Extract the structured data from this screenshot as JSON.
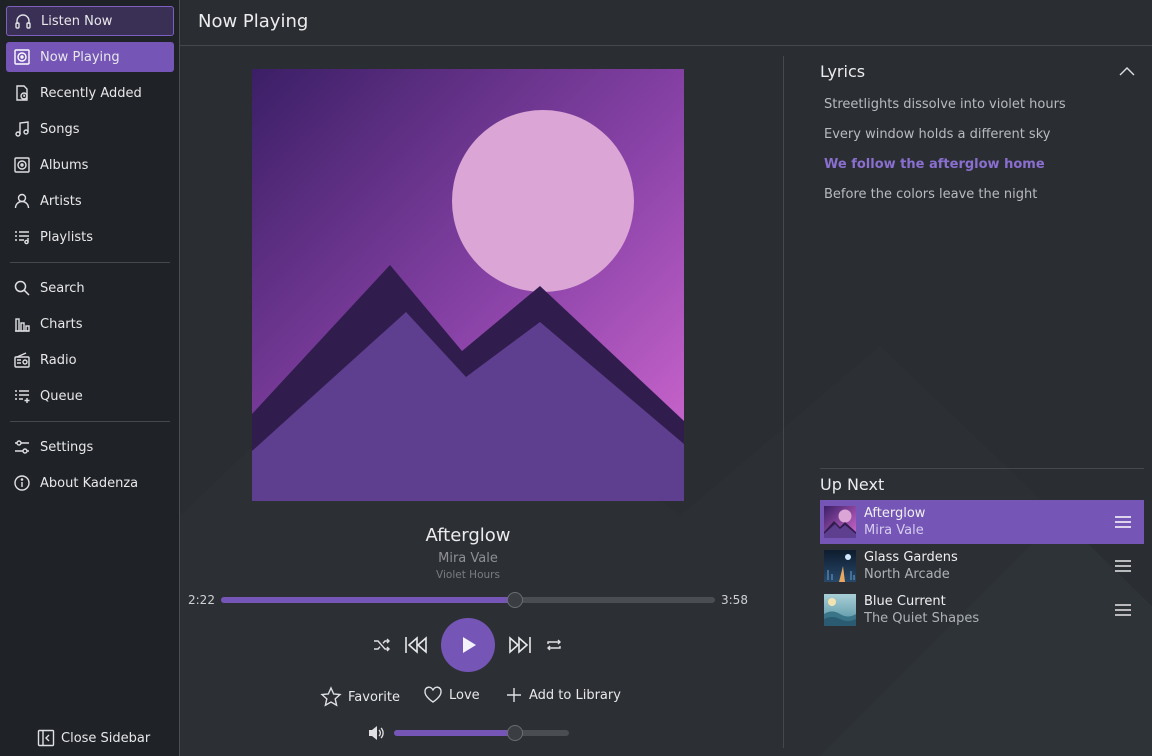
{
  "app": {
    "name": "Kadenza"
  },
  "sidebar": {
    "items": [
      {
        "label": "Listen Now",
        "icon": "headphones-icon"
      },
      {
        "label": "Now Playing",
        "icon": "now-playing-icon"
      },
      {
        "label": "Recently Added",
        "icon": "recently-added-icon"
      },
      {
        "label": "Songs",
        "icon": "music-note-icon"
      },
      {
        "label": "Albums",
        "icon": "album-icon"
      },
      {
        "label": "Artists",
        "icon": "artist-icon"
      },
      {
        "label": "Playlists",
        "icon": "playlist-icon"
      },
      {
        "label": "Search",
        "icon": "search-icon"
      },
      {
        "label": "Charts",
        "icon": "charts-icon"
      },
      {
        "label": "Radio",
        "icon": "radio-icon"
      },
      {
        "label": "Queue",
        "icon": "queue-icon"
      },
      {
        "label": "Settings",
        "icon": "settings-icon"
      },
      {
        "label": "About Kadenza",
        "icon": "info-icon"
      }
    ],
    "close_label": "Close Sidebar"
  },
  "header": {
    "title": "Now Playing"
  },
  "player": {
    "title": "Afterglow",
    "artist": "Mira Vale",
    "album": "Violet Hours",
    "elapsed": "2:22",
    "duration": "3:58",
    "progress": 0.595,
    "volume": 0.69,
    "actions": {
      "favorite": "Favorite",
      "love": "Love",
      "add": "Add to Library"
    }
  },
  "lyrics": {
    "title": "Lyrics",
    "lines": [
      "Streetlights dissolve into violet hours",
      "Every window holds a different sky",
      "We follow the afterglow home",
      "Before the colors leave the night"
    ],
    "current_index": 2
  },
  "up_next": {
    "title": "Up Next",
    "items": [
      {
        "title": "Afterglow",
        "artist": "Mira Vale"
      },
      {
        "title": "Glass Gardens",
        "artist": "North Arcade"
      },
      {
        "title": "Blue Current",
        "artist": "The Quiet Shapes"
      }
    ]
  },
  "colors": {
    "accent": "#7555b6",
    "background": "#2a2e32",
    "sidebar": "#1f2226"
  }
}
